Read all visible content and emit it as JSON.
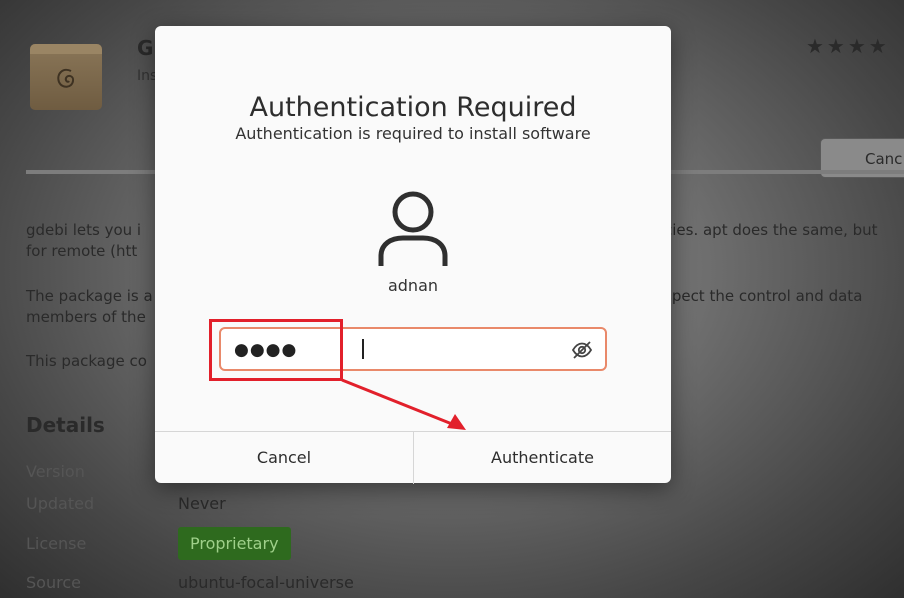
{
  "background": {
    "app_title": "G",
    "app_subtitle": "Ins",
    "rating_stars": "★★★★",
    "cancel_button": "Canc",
    "paragraphs": [
      [
        "gdebi lets you i",
        "cies. apt does the same, but"
      ],
      [
        "for remote (htt",
        ""
      ],
      [
        "The package is a",
        "spect the control and data"
      ],
      [
        "members of the",
        ""
      ],
      [
        "This package co",
        ""
      ]
    ],
    "details_heading": "Details",
    "details": [
      {
        "key": "Version",
        "value": ""
      },
      {
        "key": "Updated",
        "value": "Never"
      },
      {
        "key": "License",
        "value": "Proprietary"
      },
      {
        "key": "Source",
        "value": "ubuntu-focal-universe"
      }
    ]
  },
  "dialog": {
    "title": "Authentication Required",
    "message": "Authentication is required to install software",
    "user": "adnan",
    "password_masked": "●●●●",
    "cancel_label": "Cancel",
    "authenticate_label": "Authenticate"
  },
  "colors": {
    "field_border": "#e9896a",
    "annotation_red": "#e2202b",
    "license_badge": "#2e6a1e"
  }
}
